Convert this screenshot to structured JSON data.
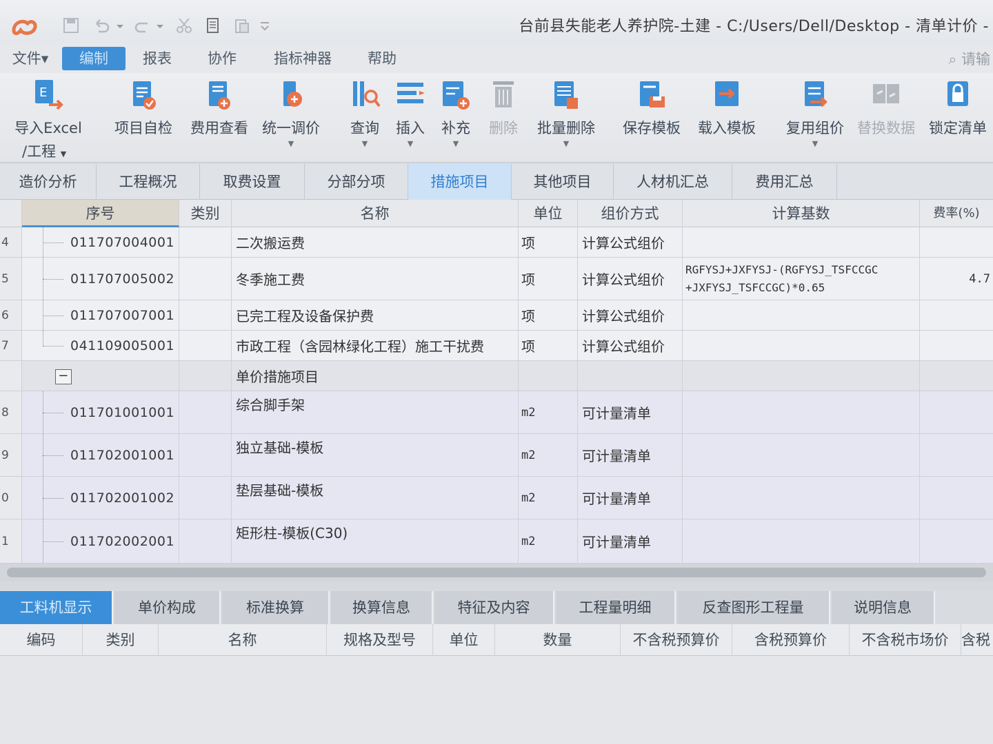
{
  "window": {
    "title": "台前县失能老人养护院-土建 - C:/Users/Dell/Desktop - 清单计价 -"
  },
  "menu": {
    "items": [
      "文件▾",
      "编制",
      "报表",
      "协作",
      "指标神器",
      "帮助"
    ],
    "search_placeholder": "请输"
  },
  "ribbon": {
    "buttons": [
      {
        "label": "导入Excel",
        "label2": "/工程",
        "icon": "import-excel-icon"
      },
      {
        "label": "项目自检",
        "icon": "self-check-icon"
      },
      {
        "label": "费用查看",
        "icon": "cost-view-icon"
      },
      {
        "label": "统一调价",
        "icon": "adjust-price-icon"
      },
      {
        "label": "查询",
        "icon": "query-icon"
      },
      {
        "label": "插入",
        "icon": "insert-icon"
      },
      {
        "label": "补充",
        "icon": "supplement-icon"
      },
      {
        "label": "删除",
        "icon": "delete-icon"
      },
      {
        "label": "批量删除",
        "icon": "batch-delete-icon"
      },
      {
        "label": "保存模板",
        "icon": "save-template-icon"
      },
      {
        "label": "载入模板",
        "icon": "load-template-icon"
      },
      {
        "label": "复用组价",
        "icon": "reuse-price-icon"
      },
      {
        "label": "替换数据",
        "icon": "replace-data-icon"
      },
      {
        "label": "锁定清单",
        "icon": "lock-list-icon"
      }
    ]
  },
  "tabs": [
    "造价分析",
    "工程概况",
    "取费设置",
    "分部分项",
    "措施项目",
    "其他项目",
    "人材机汇总",
    "费用汇总"
  ],
  "grid": {
    "headers": {
      "seq": "序号",
      "category": "类别",
      "name": "名称",
      "unit": "单位",
      "method": "组价方式",
      "base": "计算基数",
      "rate": "费率(%)"
    },
    "rows": [
      {
        "rn": "4",
        "code": "011707004001",
        "name": "二次搬运费",
        "unit": "项",
        "method": "计算公式组价",
        "base": "",
        "rate": ""
      },
      {
        "rn": "5",
        "code": "011707005002",
        "name": "冬季施工费",
        "unit": "项",
        "method": "计算公式组价",
        "base": "RGFYSJ+JXFYSJ-(RGFYSJ_TSFCCGC +JXFYSJ_TSFCCGC)*0.65",
        "rate": "4.7"
      },
      {
        "rn": "6",
        "code": "011707007001",
        "name": "已完工程及设备保护费",
        "unit": "项",
        "method": "计算公式组价",
        "base": "",
        "rate": ""
      },
      {
        "rn": "7",
        "code": "041109005001",
        "name": "市政工程（含园林绿化工程）施工干扰费",
        "unit": "项",
        "method": "计算公式组价",
        "base": "",
        "rate": ""
      }
    ],
    "section": {
      "collapse": "−",
      "name": "单价措施项目"
    },
    "unit_rows": [
      {
        "rn": "8",
        "code": "011701001001",
        "name": "综合脚手架",
        "unit": "m2",
        "method": "可计量清单"
      },
      {
        "rn": "9",
        "code": "011702001001",
        "name": "独立基础-模板",
        "unit": "m2",
        "method": "可计量清单"
      },
      {
        "rn": "0",
        "code": "011702001002",
        "name": "垫层基础-模板",
        "unit": "m2",
        "method": "可计量清单"
      },
      {
        "rn": "1",
        "code": "011702002001",
        "name": "矩形柱-模板(C30)",
        "unit": "m2",
        "method": "可计量清单"
      }
    ]
  },
  "bottom_tabs": [
    "工料机显示",
    "单价构成",
    "标准换算",
    "换算信息",
    "特征及内容",
    "工程量明细",
    "反查图形工程量",
    "说明信息"
  ],
  "bottom_headers": [
    "编码",
    "类别",
    "名称",
    "规格及型号",
    "单位",
    "数量",
    "不含税预算价",
    "含税预算价",
    "不含税市场价",
    "含税"
  ],
  "colors": {
    "accent": "#3b8fd8",
    "active_tab_bg": "#cde2f6",
    "section_bg": "#e1e3e8",
    "unit_row_bg": "#e6e6f3"
  }
}
